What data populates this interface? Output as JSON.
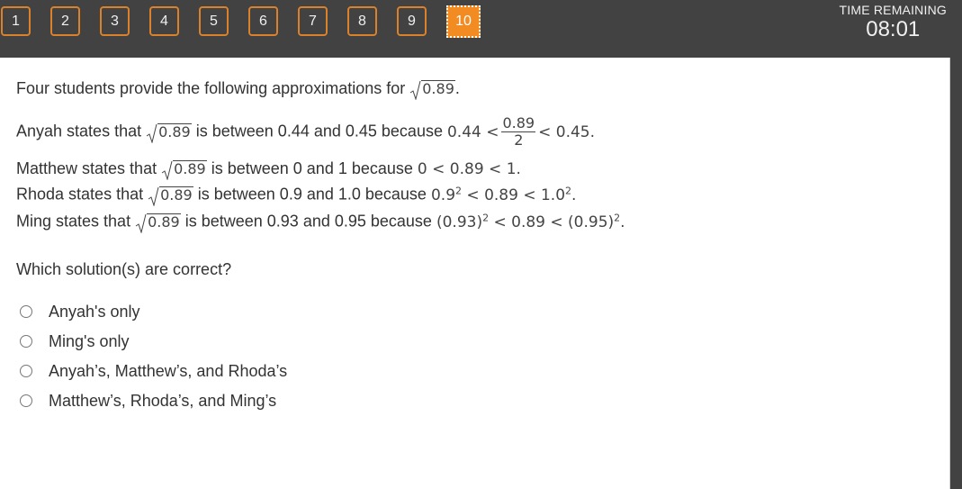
{
  "navigation": {
    "questions": [
      "1",
      "2",
      "3",
      "4",
      "5",
      "6",
      "7",
      "8",
      "9",
      "10"
    ],
    "active_question": "10",
    "colors": {
      "border": "#d9822b",
      "active_fill": "#f28b21",
      "bar_bg": "#424242"
    }
  },
  "timer": {
    "label": "TIME REMAINING",
    "value": "08:01"
  },
  "question": {
    "intro": {
      "text": "Four students provide the following approximations for",
      "radicand": "0.89",
      "end": "."
    },
    "statements": [
      {
        "student": "Anyah",
        "pre": "Anyah states that",
        "radicand": "0.89",
        "mid": "is between 0.44 and 0.45 because",
        "math": {
          "left": "0.44 <",
          "num": "0.89",
          "den": "2",
          "right": "< 0.45",
          "end": "."
        }
      },
      {
        "student": "Matthew",
        "pre": "Matthew states that",
        "radicand": "0.89",
        "mid": "is between 0 and 1 because",
        "math": "0 < 0.89 < 1."
      },
      {
        "student": "Rhoda",
        "pre": "Rhoda states that",
        "radicand": "0.89",
        "mid": "is between 0.9 and 1.0 because",
        "math": {
          "a": "0.9",
          "a_exp": "2",
          "middle": " < 0.89 < 1.0",
          "b_exp": "2",
          "end": "."
        }
      },
      {
        "student": "Ming",
        "pre": "Ming states that",
        "radicand": "0.89",
        "mid": "is between 0.93 and 0.95 because",
        "math": {
          "a": "(0.93)",
          "a_exp": "2",
          "middle": " < 0.89 < (0.95)",
          "b_exp": "2",
          "end": "."
        }
      }
    ],
    "prompt": "Which solution(s) are correct?",
    "options": [
      {
        "label": "Anyah's only",
        "selected": false
      },
      {
        "label": "Ming's only",
        "selected": false
      },
      {
        "label": "Anyah’s, Matthew’s, and Rhoda’s",
        "selected": false
      },
      {
        "label": "Matthew’s, Rhoda’s, and Ming’s",
        "selected": false
      }
    ]
  }
}
